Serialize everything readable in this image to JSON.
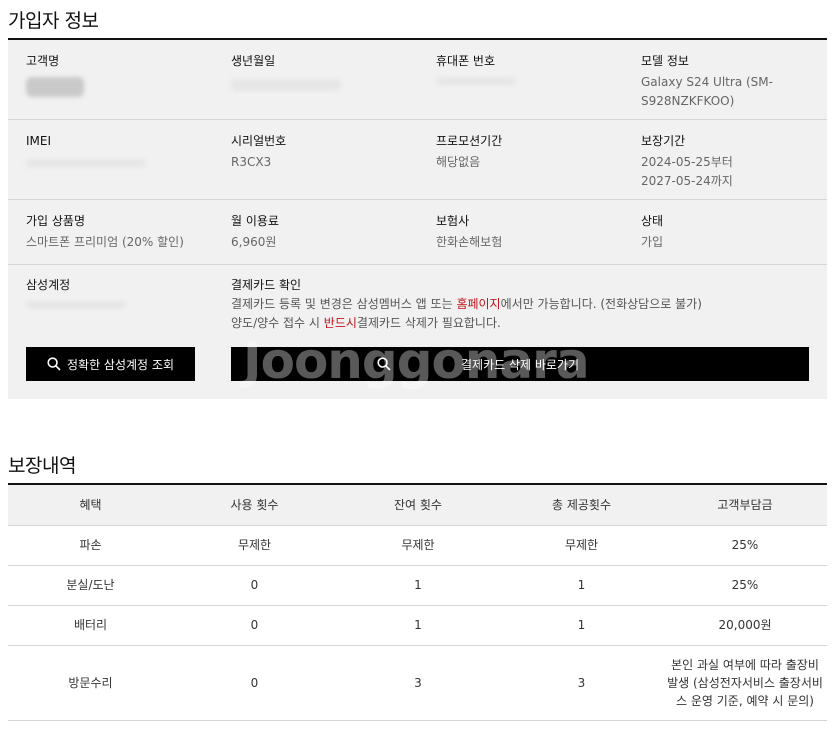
{
  "subscriber": {
    "title": "가입자 정보",
    "rows": [
      [
        {
          "label": "고객명",
          "value": ""
        },
        {
          "label": "생년월일",
          "value": ""
        },
        {
          "label": "휴대폰 번호",
          "value": ""
        },
        {
          "label": "모델 정보",
          "value": "Galaxy S24 Ultra (SM-S928NZKFKOO)"
        }
      ],
      [
        {
          "label": "IMEI",
          "value": ""
        },
        {
          "label": "시리얼번호",
          "value": "R3CX3"
        },
        {
          "label": "프로모션기간",
          "value": "해당없음"
        },
        {
          "label": "보장기간",
          "value": "2024-05-25부터",
          "value2": "2027-05-24까지"
        }
      ],
      [
        {
          "label": "가입 상품명",
          "value": "스마트폰 프리미엄 (20% 할인)"
        },
        {
          "label": "월 이용료",
          "value": "6,960원"
        },
        {
          "label": "보험사",
          "value": "한화손해보험"
        },
        {
          "label": "상태",
          "value": "가입"
        }
      ]
    ],
    "samsung_account_label": "삼성계정",
    "card_check": {
      "label": "결제카드 확인",
      "line1_a": "결제카드 등록 및 변경은 삼성멤버스 앱 또는 ",
      "line1_link": "홈페이지",
      "line1_b": "에서만 가능합니다. (전화상담으로 불가)",
      "line2_a": "양도/양수 접수 시 ",
      "line2_red": "반드시",
      "line2_b": "결제카드 삭제가 필요합니다."
    },
    "buttons": {
      "account_lookup": "정확한 삼성계정 조회",
      "card_delete": "결제카드 삭제 바로가기"
    },
    "watermark": "Joonggonara"
  },
  "coverage": {
    "title": "보장내역",
    "headers": [
      "혜택",
      "사용 횟수",
      "잔여 횟수",
      "총 제공횟수",
      "고객부담금"
    ],
    "rows": [
      [
        "파손",
        "무제한",
        "무제한",
        "무제한",
        "25%"
      ],
      [
        "분실/도난",
        "0",
        "1",
        "1",
        "25%"
      ],
      [
        "배터리",
        "0",
        "1",
        "1",
        "20,000원"
      ],
      [
        "방문수리",
        "0",
        "3",
        "3",
        "본인 과실 여부에 따라 출장비 발생 (삼성전자서비스 출장서비스 운영 기준, 예약 시 문의)"
      ]
    ]
  },
  "colors": {
    "accent_red": "#c0141c",
    "button_bg": "#000000",
    "panel_bg": "#f1f1f1"
  }
}
